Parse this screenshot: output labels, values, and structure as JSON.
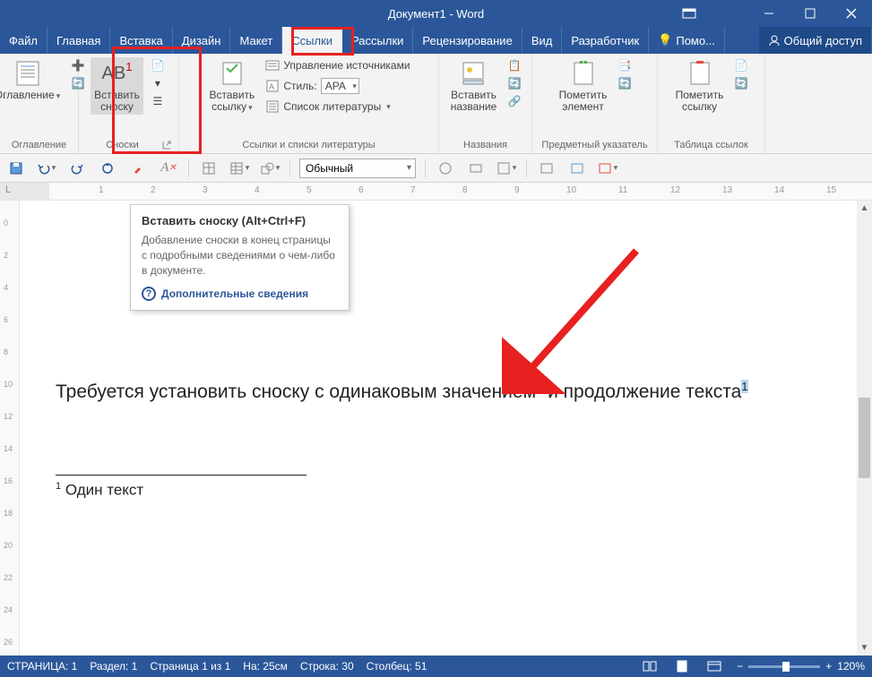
{
  "window": {
    "title": "Документ1 - Word"
  },
  "tabs": {
    "file": "Файл",
    "items": [
      "Главная",
      "Вставка",
      "Дизайн",
      "Макет",
      "Ссылки",
      "Рассылки",
      "Рецензирование",
      "Вид",
      "Разработчик"
    ],
    "active_index": 4,
    "help": "Помо...",
    "share": "Общий доступ"
  },
  "ribbon": {
    "toc": {
      "btn": "Оглавление",
      "group": "Оглавление"
    },
    "footnotes": {
      "insert": "Вставить\nсноску",
      "ab_label": "AB",
      "group": "Сноски"
    },
    "citations": {
      "insert": "Вставить\nссылку",
      "manage": "Управление источниками",
      "style_label": "Стиль:",
      "style_value": "APA",
      "biblio": "Список литературы",
      "group": "Ссылки и списки литературы"
    },
    "captions": {
      "insert": "Вставить\nназвание",
      "group": "Названия"
    },
    "index": {
      "mark": "Пометить\nэлемент",
      "group": "Предметный указатель"
    },
    "toa": {
      "mark": "Пометить\nссылку",
      "group": "Таблица ссылок"
    }
  },
  "qat": {
    "style_value": "Обычный"
  },
  "tooltip": {
    "title": "Вставить сноску (Alt+Ctrl+F)",
    "body": "Добавление сноски в конец страницы с подробными сведениями о чем-либо в документе.",
    "more": "Дополнительные сведения"
  },
  "document": {
    "line_part1": "Требуется установить сноску с одинаковым значением",
    "sup1": "1",
    "line_part2": " и продолжение текста",
    "sup2": "1",
    "footnote_mark": "1",
    "footnote_text": " Один текст"
  },
  "status": {
    "page": "СТРАНИЦА: 1",
    "section": "Раздел: 1",
    "page_of": "Страница 1 из 1",
    "at": "На: 25см",
    "line": "Строка: 30",
    "col": "Столбец: 51",
    "zoom": "120%"
  },
  "ruler": {
    "marks": [
      1,
      2,
      3,
      4,
      5,
      6,
      7,
      8,
      9,
      10,
      11,
      12,
      13,
      14,
      15
    ]
  }
}
